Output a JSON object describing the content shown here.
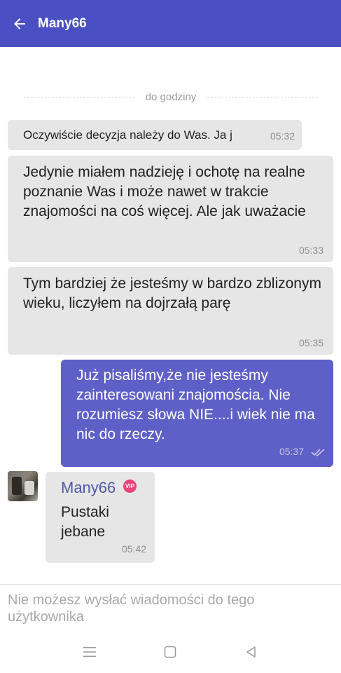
{
  "header": {
    "title": "Many66",
    "back_icon": "arrow-left-icon",
    "background": "#4a4fc1"
  },
  "divider": {
    "text": "do godziny"
  },
  "messages": [
    {
      "text": "Oczywiście decyzja należy do Was. Ja j",
      "time": "05:32",
      "direction": "incoming"
    },
    {
      "text": "Jedynie miałem nadzieję i ochotę na realne poznanie Was i może nawet w trakcie znajomości na coś więcej. Ale jak uważacie",
      "time": "05:33",
      "direction": "incoming"
    },
    {
      "text": "Tym bardziej że jesteśmy w bardzo zblizonym wieku, liczyłem na dojrzałą parę",
      "time": "05:35",
      "direction": "incoming"
    },
    {
      "text": "Już pisaliśmy,że nie jesteśmy zainteresowani znajomościa. Nie rozumiesz słowa NIE....i wiek nie ma nic do rzeczy.",
      "time": "05:37",
      "direction": "outgoing",
      "status_icon": "double-check-icon",
      "color": "#5f5fc8"
    },
    {
      "sender": "Many66",
      "badge": "VIP",
      "text": "Pustaki jebane",
      "time": "05:42",
      "direction": "incoming"
    }
  ],
  "compose": {
    "disabled_text": "Nie możesz wysłać wiadomości do tego użytkownika"
  },
  "navbar": {
    "icons": [
      "menu-icon",
      "home-square-icon",
      "back-triangle-icon"
    ]
  }
}
